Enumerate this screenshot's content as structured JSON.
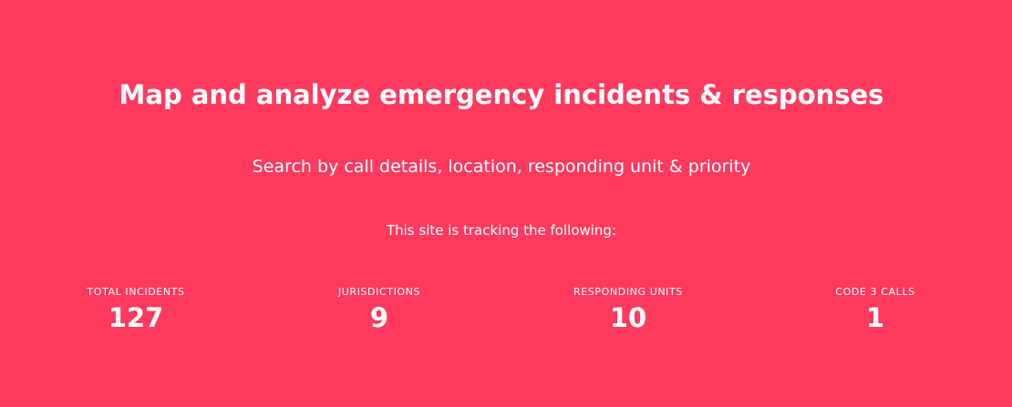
{
  "hero": {
    "title": "Map and analyze emergency incidents & responses",
    "subtitle": "Search by call details, location, responding unit & priority",
    "tracking_text": "This site is tracking the following:"
  },
  "stats": [
    {
      "label": "TOTAL INCIDENTS",
      "value": "127"
    },
    {
      "label": "JURISDICTIONS",
      "value": "9"
    },
    {
      "label": "RESPONDING UNITS",
      "value": "10"
    },
    {
      "label": "CODE 3 CALLS",
      "value": "1"
    }
  ],
  "colors": {
    "background": "#ff3a5e",
    "text": "#ffffff"
  }
}
